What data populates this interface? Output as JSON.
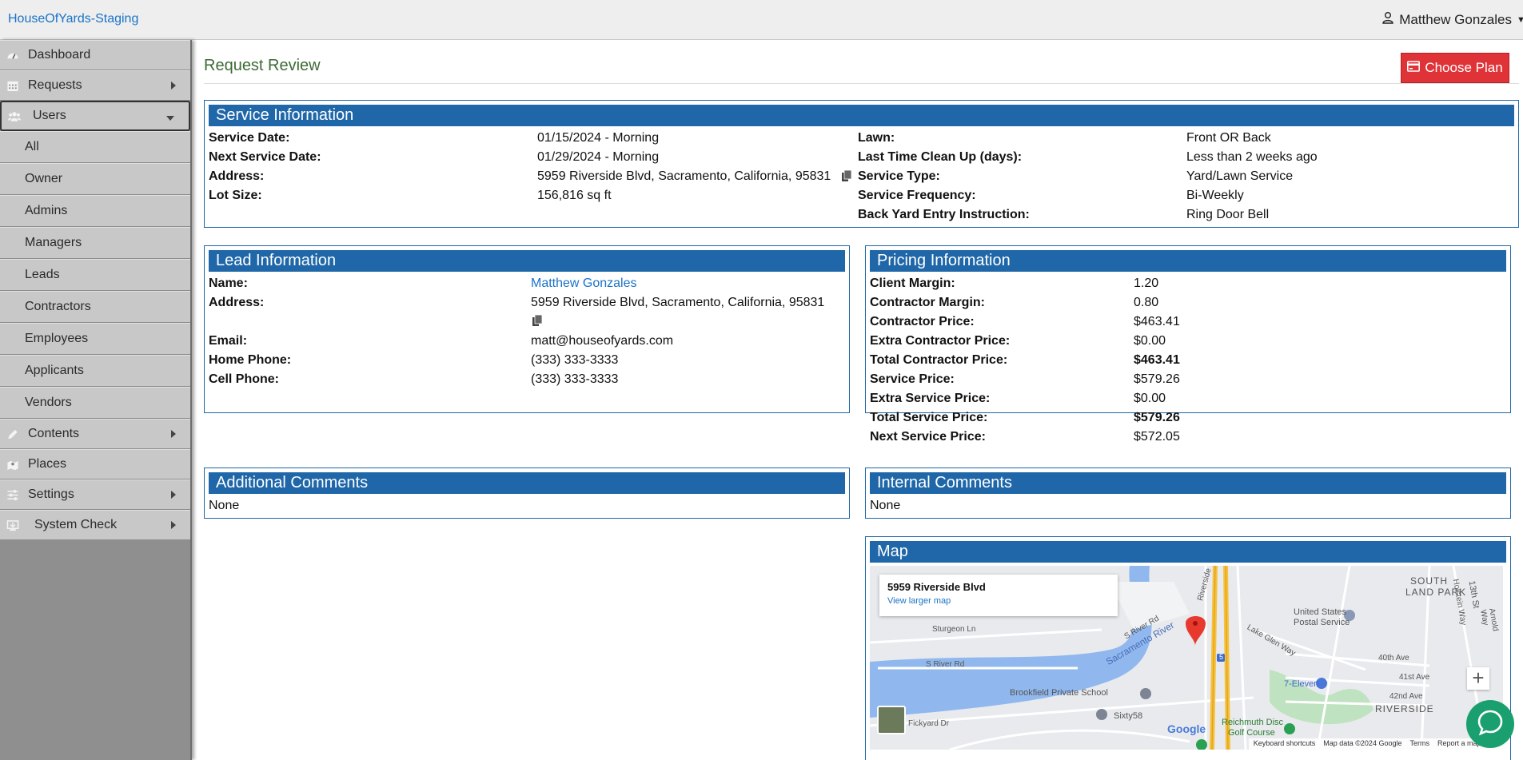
{
  "app": {
    "brand": "HouseOfYards-Staging",
    "user_name": "Matthew Gonzales"
  },
  "sidebar": {
    "items": [
      {
        "label": "Dashboard",
        "icon": "dashboard-icon"
      },
      {
        "label": "Requests",
        "icon": "calendar-icon"
      },
      {
        "label": "Users",
        "icon": "users-icon"
      },
      {
        "label": "Contents",
        "icon": "pencil-icon"
      },
      {
        "label": "Places",
        "icon": "places-icon"
      },
      {
        "label": "Settings",
        "icon": "sliders-icon"
      },
      {
        "label": "System Check",
        "icon": "monitor-icon"
      }
    ],
    "users_sub": [
      "All",
      "Owner",
      "Admins",
      "Managers",
      "Leads",
      "Contractors",
      "Employees",
      "Applicants",
      "Vendors"
    ]
  },
  "page": {
    "title": "Request Review",
    "choose_plan": "Choose Plan"
  },
  "service_info": {
    "title": "Service Information",
    "left": [
      {
        "label": "Service Date:",
        "value": "01/15/2024 - Morning"
      },
      {
        "label": "Next Service Date:",
        "value": "01/29/2024 - Morning"
      },
      {
        "label": "Address:",
        "value": "5959 Riverside Blvd, Sacramento, California, 95831"
      },
      {
        "label": "Lot Size:",
        "value": "156,816 sq ft"
      }
    ],
    "right": [
      {
        "label": "Lawn:",
        "value": "Front OR Back"
      },
      {
        "label": "Last Time Clean Up (days):",
        "value": "Less than 2 weeks ago"
      },
      {
        "label": "Service Type:",
        "value": "Yard/Lawn Service"
      },
      {
        "label": "Service Frequency:",
        "value": "Bi-Weekly"
      },
      {
        "label": "Back Yard Entry Instruction:",
        "value": "Ring Door Bell"
      }
    ]
  },
  "lead_info": {
    "title": "Lead Information",
    "name_label": "Name:",
    "name": "Matthew Gonzales",
    "address_label": "Address:",
    "address": "5959 Riverside Blvd, Sacramento, California, 95831",
    "email_label": "Email:",
    "email": "matt@houseofyards.com",
    "home_label": "Home Phone:",
    "home": "(333) 333-3333",
    "cell_label": "Cell Phone:",
    "cell": "(333) 333-3333"
  },
  "pricing_info": {
    "title": "Pricing Information",
    "rows": [
      {
        "label": "Client Margin:",
        "value": "1.20",
        "bold": false
      },
      {
        "label": "Contractor Margin:",
        "value": "0.80",
        "bold": false
      },
      {
        "label": "Contractor Price:",
        "value": "$463.41",
        "bold": false
      },
      {
        "label": "Extra Contractor Price:",
        "value": "$0.00",
        "bold": false
      },
      {
        "label": "Total Contractor Price:",
        "value": "$463.41",
        "bold": true
      },
      {
        "label": "Service Price:",
        "value": "$579.26",
        "bold": false
      },
      {
        "label": "Extra Service Price:",
        "value": "$0.00",
        "bold": false
      },
      {
        "label": "Total Service Price:",
        "value": "$579.26",
        "bold": true
      },
      {
        "label": "Next Service Price:",
        "value": "$572.05",
        "bold": false
      }
    ]
  },
  "additional_comments": {
    "title": "Additional Comments",
    "text": "None"
  },
  "internal_comments": {
    "title": "Internal Comments",
    "text": "None"
  },
  "map": {
    "title": "Map",
    "card_address": "5959 Riverside Blvd",
    "card_link": "View larger map",
    "labels": {
      "south_land": "SOUTH",
      "land_park": "LAND PARK",
      "usps_1": "United States",
      "usps_2": "Postal Service",
      "sturgeon": "Sturgeon Ln",
      "s_river_rd_1": "S River Rd",
      "s_river_rd_2": "S River Rd",
      "sacramento_river": "Sacramento River",
      "riverside": "Riverside",
      "brookfield": "Brookfield Private School",
      "sixty58": "Sixty58",
      "seven_eleven": "7-Eleven",
      "riverside_area": "RIVERSIDE",
      "reichmuth": "Reichmuth Disc",
      "golf": "Golf Course",
      "lake_glen": "Lake Glen Way",
      "ave_40": "40th Ave",
      "ave_41": "41st Ave",
      "ave_42": "42nd Ave",
      "holstein": "Holstein Way",
      "st_13": "13th St",
      "arnold": "Arnold Way",
      "fickyard": "Fickyard Dr",
      "i5": "5",
      "google": "Google"
    },
    "footer": [
      "Keyboard shortcuts",
      "Map data ©2024 Google",
      "Terms",
      "Report a map error"
    ],
    "zoom_in": "+"
  },
  "colors": {
    "panel_blue": "#1f67a8",
    "brand_link": "#1a73c8",
    "choose_plan_red": "#e03338",
    "title_green": "#3d6b35",
    "chat_green": "#1aa06e"
  }
}
